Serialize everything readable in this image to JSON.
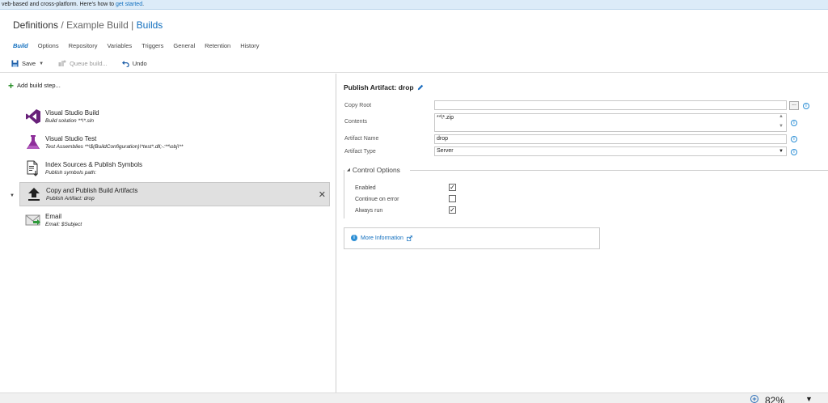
{
  "banner": {
    "text": "veb-based and cross-platform. Here's how to ",
    "link": "get started",
    "end": "."
  },
  "header": {
    "crumb1": "Definitions",
    "sep1": "/",
    "crumb2": "Example Build",
    "sep2": "|",
    "crumb3": "Builds"
  },
  "tabs": [
    "Build",
    "Options",
    "Repository",
    "Variables",
    "Triggers",
    "General",
    "Retention",
    "History"
  ],
  "toolbar": {
    "save": "Save",
    "queue": "Queue build...",
    "undo": "Undo"
  },
  "left": {
    "add_step": "Add build step...",
    "steps": [
      {
        "name": "Visual Studio Build",
        "sub": "Build solution **\\*.sln"
      },
      {
        "name": "Visual Studio Test",
        "sub": "Test Assemblies **\\$(BuildConfiguration)\\*test*.dll;-:**\\obj\\**"
      },
      {
        "name": "Index Sources & Publish Symbols",
        "sub": "Publish symbols path:"
      },
      {
        "name": "Copy and Publish Build Artifacts",
        "sub": "Publish Artifact: drop"
      },
      {
        "name": "Email",
        "sub": "Email: $Subject"
      }
    ]
  },
  "right": {
    "title": "Publish Artifact: drop",
    "fields": {
      "copy_root": {
        "label": "Copy Root",
        "value": ""
      },
      "contents": {
        "label": "Contents",
        "value": "**\\*.zip"
      },
      "artifact_name": {
        "label": "Artifact Name",
        "value": "drop"
      },
      "artifact_type": {
        "label": "Artifact Type",
        "value": "Server"
      }
    },
    "control_options": {
      "title": "Control Options",
      "enabled": {
        "label": "Enabled",
        "checked": true
      },
      "continue_on_error": {
        "label": "Continue on error",
        "checked": false
      },
      "always_run": {
        "label": "Always run",
        "checked": true
      }
    },
    "more_info": "More Information"
  },
  "statusbar": {
    "zoom": "82%"
  },
  "colors": {
    "accent": "#106ebe",
    "info": "#2d8fd5",
    "selected_row": "#e0e0e0"
  }
}
